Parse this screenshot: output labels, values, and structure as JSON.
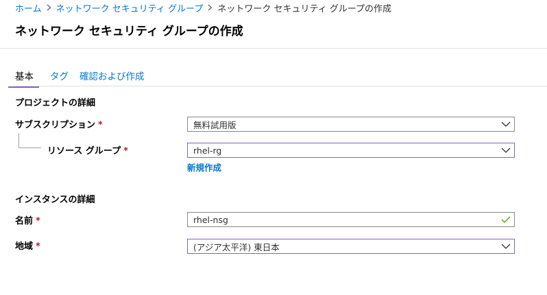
{
  "breadcrumb": {
    "home": "ホーム",
    "nsg": "ネットワーク セキュリティ グループ",
    "current": "ネットワーク セキュリティ グループの作成"
  },
  "page": {
    "title": "ネットワーク セキュリティ グループの作成"
  },
  "tabs": [
    {
      "label": "基本",
      "active": true
    },
    {
      "label": "タグ",
      "active": false
    },
    {
      "label": "確認および作成",
      "active": false
    }
  ],
  "project": {
    "heading": "プロジェクトの詳細",
    "subscription": {
      "label": "サブスクリプション",
      "required": "*",
      "value": "無料試用版"
    },
    "resource_group": {
      "label": "リソース グループ",
      "required": "*",
      "value": "rhel-rg",
      "create_new": "新規作成"
    }
  },
  "instance": {
    "heading": "インスタンスの詳細",
    "name": {
      "label": "名前",
      "required": "*",
      "value": "rhel-nsg"
    },
    "region": {
      "label": "地域",
      "required": "*",
      "value": "(アジア太平洋) 東日本"
    }
  },
  "colors": {
    "link": "#0078d4",
    "focus_border": "#8661c5",
    "required": "#a4262c",
    "valid_check": "#57a300"
  },
  "icons": {
    "breadcrumb_separator": "chevron-right-icon",
    "dropdown": "chevron-down-icon",
    "valid": "checkmark-icon"
  }
}
